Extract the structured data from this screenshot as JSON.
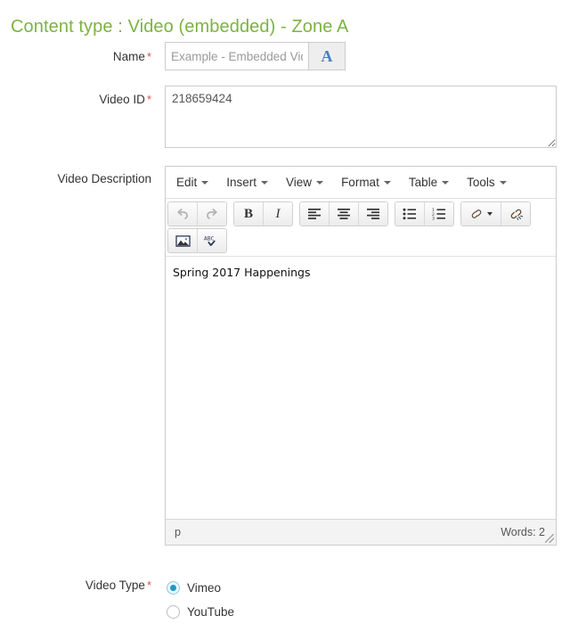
{
  "page": {
    "title": "Content type : Video (embedded) - Zone A",
    "title_color": "#7cb342",
    "required_marker": "*"
  },
  "fields": {
    "name": {
      "label": "Name",
      "required": true,
      "value": "",
      "placeholder": "Example - Embedded Video",
      "addon_label": "A",
      "addon_icon": "font-picker-icon"
    },
    "video_id": {
      "label": "Video ID",
      "required": true,
      "value": "218659424",
      "placeholder": ""
    },
    "video_description": {
      "label": "Video Description",
      "required": false,
      "content": "Spring 2017 Happenings"
    },
    "video_type": {
      "label": "Video Type",
      "required": true,
      "selected": "Vimeo",
      "options": [
        {
          "label": "Vimeo",
          "checked": true
        },
        {
          "label": "YouTube",
          "checked": false
        }
      ],
      "accent_color": "#2196c4"
    }
  },
  "editor": {
    "menubar": [
      {
        "label": "Edit"
      },
      {
        "label": "Insert"
      },
      {
        "label": "View"
      },
      {
        "label": "Format"
      },
      {
        "label": "Table"
      },
      {
        "label": "Tools"
      }
    ],
    "toolbar_row1": [
      {
        "icon": "undo-icon",
        "title": "Undo",
        "disabled": true
      },
      {
        "icon": "redo-icon",
        "title": "Redo",
        "disabled": true
      },
      {
        "icon": "bold-icon",
        "title": "Bold",
        "glyph": "B"
      },
      {
        "icon": "italic-icon",
        "title": "Italic",
        "glyph": "I"
      },
      {
        "icon": "align-left-icon",
        "title": "Align left"
      },
      {
        "icon": "align-center-icon",
        "title": "Align center"
      },
      {
        "icon": "align-right-icon",
        "title": "Align right"
      },
      {
        "icon": "bullet-list-icon",
        "title": "Bullet list"
      },
      {
        "icon": "numbered-list-icon",
        "title": "Numbered list"
      },
      {
        "icon": "link-icon",
        "title": "Insert/edit link",
        "has_dropdown": true
      },
      {
        "icon": "unlink-icon",
        "title": "Remove link"
      }
    ],
    "toolbar_row2": [
      {
        "icon": "image-icon",
        "title": "Insert/edit image"
      },
      {
        "icon": "spellcheck-icon",
        "title": "Spellcheck",
        "glyph": "ABC"
      }
    ],
    "statusbar": {
      "path": "p",
      "word_count": "Words: 2"
    }
  }
}
